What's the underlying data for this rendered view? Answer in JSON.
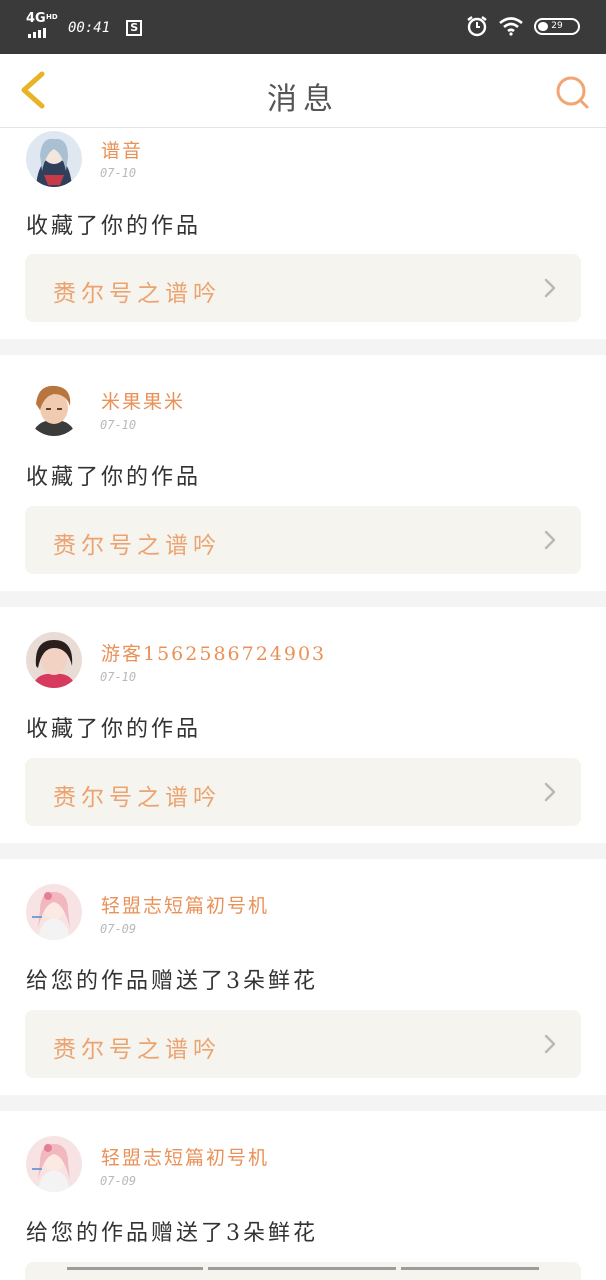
{
  "status_bar": {
    "network": "4G",
    "network_sup": "HD",
    "time": "00:41",
    "s_icon": "S",
    "battery_level": "29"
  },
  "header": {
    "title": "消息",
    "back_icon": "chevron-left-icon",
    "search_icon": "search-icon"
  },
  "colors": {
    "accent": "#e99158",
    "work_card_bg": "#f6f4ee",
    "header_bg": "#ffffff",
    "status_bar_bg": "#3a3a3a"
  },
  "messages": [
    {
      "user": "谱音",
      "date": "07-10",
      "text": "收藏了你的作品",
      "work": "赉尔号之谱吟",
      "avatar": "anime-girl-avatar"
    },
    {
      "user": "米果果米",
      "date": "07-10",
      "text": "收藏了你的作品",
      "work": "赉尔号之谱吟",
      "avatar": "photo-boy-avatar"
    },
    {
      "user": "游客1562586724903",
      "date": "07-10",
      "text": "收藏了你的作品",
      "work": "赉尔号之谱吟",
      "avatar": "photo-girl-avatar"
    },
    {
      "user": "轻盟志短篇初号机",
      "date": "07-09",
      "text": "给您的作品赠送了3朵鲜花",
      "work": "赉尔号之谱吟",
      "avatar": "pink-anime-avatar"
    },
    {
      "user": "轻盟志短篇初号机",
      "date": "07-09",
      "text": "给您的作品赠送了3朵鲜花",
      "work": "",
      "avatar": "pink-anime-avatar"
    }
  ]
}
